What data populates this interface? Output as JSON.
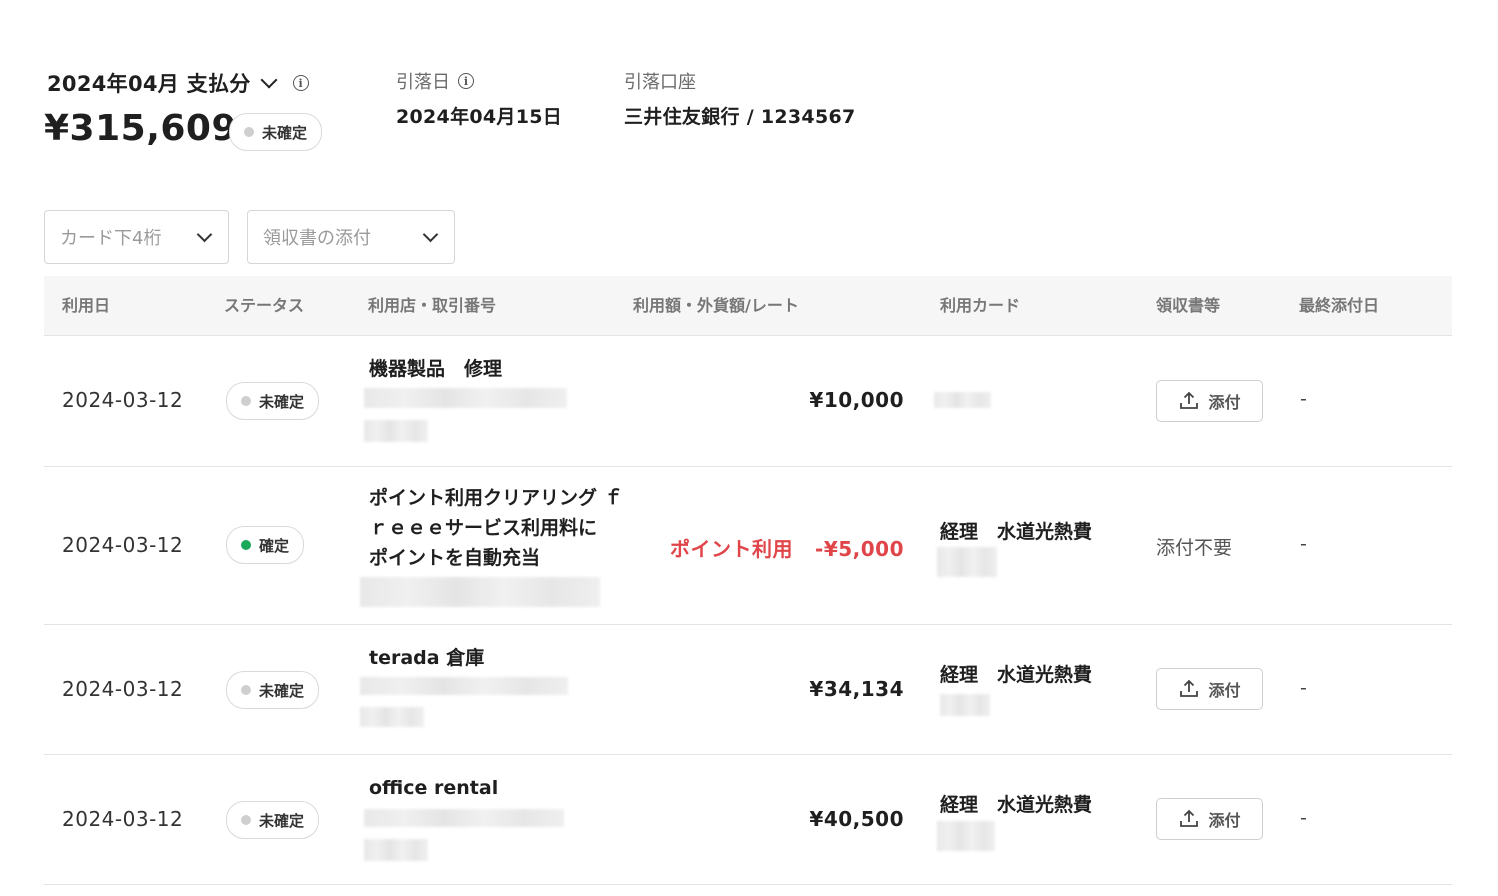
{
  "header": {
    "period_label": "2024年04月 支払分",
    "total_amount": "¥315,609",
    "status": "未確定",
    "withdrawal_date_label": "引落日",
    "withdrawal_date": "2024年04月15日",
    "account_label": "引落口座",
    "account": "三井住友銀行 / 1234567"
  },
  "filters": {
    "card_last4_placeholder": "カード下4桁",
    "receipt_placeholder": "領収書の添付"
  },
  "table": {
    "columns": [
      "利用日",
      "ステータス",
      "利用店・取引番号",
      "利用額・外貨額/レート",
      "利用カード",
      "領収書等",
      "最終添付日"
    ],
    "rows": [
      {
        "date": "2024-03-12",
        "status": "未確定",
        "merchant": "機器製品　修理",
        "amount": "¥10,000",
        "card": "",
        "receipt": "添付",
        "last_attached": "-"
      },
      {
        "date": "2024-03-12",
        "status": "確定",
        "merchant_lines": [
          "ポイント利用クリアリング ｆ",
          "ｒｅｅｅサービス利用料に",
          "ポイントを自動充当"
        ],
        "amount_label": "ポイント利用",
        "amount": "-¥5,000",
        "card": "経理　水道光熱費",
        "receipt": "添付不要",
        "last_attached": "-"
      },
      {
        "date": "2024-03-12",
        "status": "未確定",
        "merchant": "terada 倉庫",
        "amount": "¥34,134",
        "card": "経理　水道光熱費",
        "receipt": "添付",
        "last_attached": "-"
      },
      {
        "date": "2024-03-12",
        "status": "未確定",
        "merchant": "office rental",
        "amount": "¥40,500",
        "card": "経理　水道光熱費",
        "receipt": "添付",
        "last_attached": "-"
      }
    ]
  },
  "colors": {
    "confirmed_dot": "#1aa85a",
    "pending_dot": "#cfcfcf",
    "negative": "#e0454a"
  },
  "icons": [
    "chevron-down-icon",
    "info-icon",
    "upload-icon"
  ]
}
